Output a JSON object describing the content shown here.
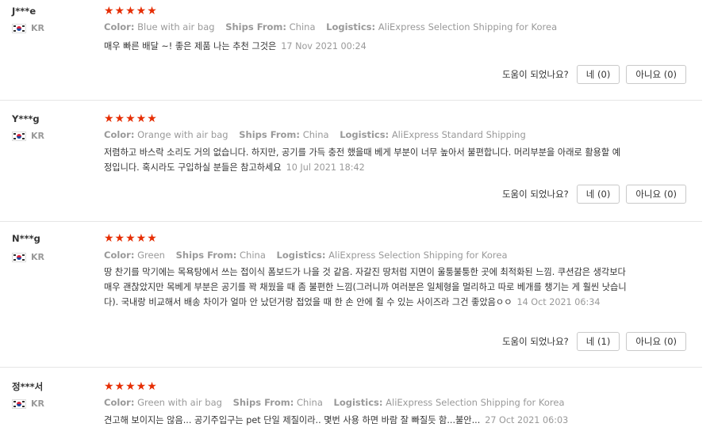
{
  "labels": {
    "color": "Color:",
    "ships_from": "Ships From:",
    "logistics": "Logistics:",
    "helpful_question": "도움이 되었나요?"
  },
  "stars": "★★★★★",
  "reviews": [
    {
      "user": "J***e",
      "country": "KR",
      "rating": 5,
      "color": "Blue with air bag",
      "ships_from": "China",
      "logistics": "AliExpress Selection Shipping for Korea",
      "text": "매우 빠른 배달 ~! 좋은 제품 나는 추천 그것은",
      "date": "17 Nov 2021 00:24",
      "yes_label": "네 (0)",
      "no_label": "아니요 (0)"
    },
    {
      "user": "Y***g",
      "country": "KR",
      "rating": 5,
      "color": "Orange with air bag",
      "ships_from": "China",
      "logistics": "AliExpress Standard Shipping",
      "text": "저렴하고 바스락 소리도 거의 없습니다. 하지만, 공기를 가득 충전 했을때 베게 부분이 너무 높아서 불편합니다. 머리부분을 아래로 활용할 예정입니다. 혹시라도 구입하실 분들은 참고하세요",
      "date": "10 Jul 2021 18:42",
      "yes_label": "네 (0)",
      "no_label": "아니요 (0)"
    },
    {
      "user": "N***g",
      "country": "KR",
      "rating": 5,
      "color": "Green",
      "ships_from": "China",
      "logistics": "AliExpress Selection Shipping for Korea",
      "text": "땅 찬기를 막기에는 목욕탕에서 쓰는 접이식 폼보드가 나을 것 같음. 자갈진 땅처럼 지면이 울퉁불퉁한 곳에 최적화된 느낌. 쿠션감은 생각보다 매우 괜찮았지만 목베게 부분은 공기를 꽉 채웠을 때 좀 불편한 느낌(그러니까 여러분은 일체형을 멀리하고 따로 베개를 챙기는 게 훨씬 낫습니다). 국내랑 비교해서 배송 차이가 얼마 안 났던거랑 접었을 때 한 손 안에 쥘 수 있는 사이즈라 그건 좋았음ㅇㅇ",
      "date": "14 Oct 2021 06:34",
      "yes_label": "네 (1)",
      "no_label": "아니요 (0)"
    },
    {
      "user": "정***서",
      "country": "KR",
      "rating": 5,
      "color": "Green with air bag",
      "ships_from": "China",
      "logistics": "AliExpress Selection Shipping for Korea",
      "text": "견고해 보이지는 않음... 공기주입구는 pet 단일 제질이라.. 몇번 사용 하면 바람 잘 빠질듯 함...불안...",
      "date": "27 Oct 2021 06:03"
    }
  ]
}
